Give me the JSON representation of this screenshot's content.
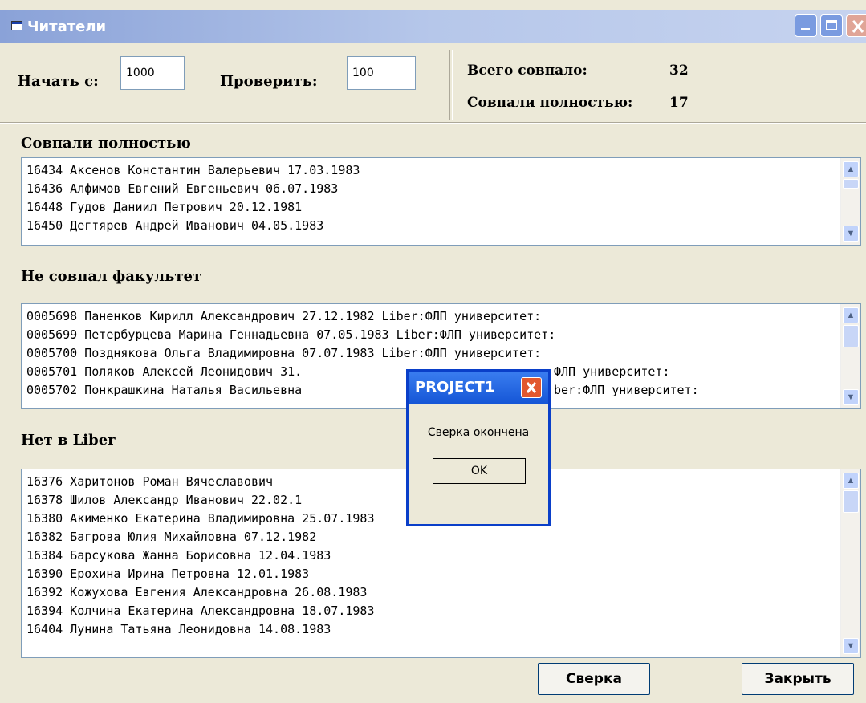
{
  "window": {
    "title": "Читатели",
    "icon": "window-icon"
  },
  "top": {
    "start_label": "Начать с:",
    "start_value": "1000",
    "check_label": "Проверить:",
    "check_value": "100",
    "total_label": "Всего совпало:",
    "total_value": "32",
    "full_label": "Совпали полностью:",
    "full_value": "17"
  },
  "sections": {
    "full": {
      "heading": "Совпали полностью",
      "rows": [
        "16434 Аксенов Константин Валерьевич 17.03.1983",
        "16436 Алфимов Евгений Евгеньевич 06.07.1983",
        "16448 Гудов Даниил Петрович 20.12.1981",
        "16450 Дегтярев Андрей Иванович 04.05.1983"
      ]
    },
    "faculty": {
      "heading": "Не совпал факультет",
      "rows": [
        "0005698 Паненков Кирилл Александрович 27.12.1982 Liber:ФЛП университет:",
        "0005699 Петербурцева Марина Геннадьевна 07.05.1983 Liber:ФЛП университет:",
        "0005700 Позднякова Ольга Владимировна 07.07.1983 Liber:ФЛП университет:",
        "0005701 Поляков Алексей Леонидович 31.",
        "0005702 Понкрашкина Наталья Васильевна"
      ],
      "row_tails": [
        "",
        "",
        "",
        "ФЛП университет:",
        "ber:ФЛП университет:"
      ]
    },
    "liber": {
      "heading": "Нет в Liber",
      "rows": [
        "16376 Харитонов Роман Вячеславович",
        "16378 Шилов Александр Иванович 22.02.1",
        "16380 Акименко Екатерина Владимировна 25.07.1983",
        "16382 Багрова Юлия Михайловна 07.12.1982",
        "16384 Барсукова Жанна Борисовна 12.04.1983",
        "16390 Ерохина Ирина Петровна 12.01.1983",
        "16392 Кожухова Евгения Александровна 26.08.1983",
        "16394 Колчина Екатерина Александровна 18.07.1983",
        "16404 Лунина Татьяна Леонидовна 14.08.1983"
      ]
    }
  },
  "buttons": {
    "compare": "Сверка",
    "close": "Закрыть"
  },
  "dialog": {
    "title": "PROJECT1",
    "message": "Сверка окончена",
    "ok": "OK"
  },
  "colors": {
    "dialog_border": "#0a3fc9",
    "dialog_close": "#e2582f"
  }
}
